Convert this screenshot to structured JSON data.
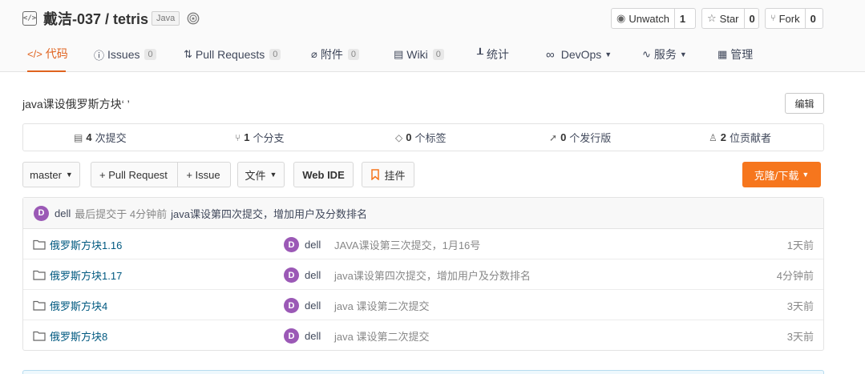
{
  "repo": {
    "title": "戴洁-037 / tetris",
    "language": "Java",
    "repo_icon": "code-repo-icon",
    "badge_icon": "recommend-badge-icon"
  },
  "social": {
    "watch": {
      "label": "Unwatch",
      "count": "1",
      "icon": "eye-icon"
    },
    "star": {
      "label": "Star",
      "count": "0",
      "icon": "star-icon"
    },
    "fork": {
      "label": "Fork",
      "count": "0",
      "icon": "fork-icon"
    }
  },
  "tabs": [
    {
      "label": "代码",
      "icon": "code-icon",
      "active": true
    },
    {
      "label": "Issues",
      "count": "0",
      "icon": "issue-icon"
    },
    {
      "label": "Pull Requests",
      "count": "0",
      "icon": "pull-request-icon"
    },
    {
      "label": "附件",
      "count": "0",
      "icon": "paperclip-icon"
    },
    {
      "label": "Wiki",
      "count": "0",
      "icon": "book-icon"
    },
    {
      "label": "统计",
      "icon": "bar-chart-icon"
    },
    {
      "label": "DevOps",
      "icon": "infinity-icon",
      "dropdown": true
    },
    {
      "label": "服务",
      "icon": "pulse-icon",
      "dropdown": true
    },
    {
      "label": "管理",
      "icon": "settings-doc-icon"
    }
  ],
  "description": "java课设俄罗斯方块‘ ’",
  "edit_label": "编辑",
  "stats": [
    {
      "count": "4",
      "label": "次提交",
      "icon": "commit-icon"
    },
    {
      "count": "1",
      "label": "个分支",
      "icon": "branch-icon"
    },
    {
      "count": "0",
      "label": "个标签",
      "icon": "tag-icon"
    },
    {
      "count": "0",
      "label": "个发行版",
      "icon": "release-icon"
    },
    {
      "count": "2",
      "label": "位贡献者",
      "icon": "contributors-icon"
    }
  ],
  "toolbar": {
    "branch": "master",
    "new_pr": "+ Pull Request",
    "new_issue": "+ Issue",
    "files": "文件",
    "web_ide": "Web IDE",
    "widget": "挂件",
    "clone": "克隆/下载"
  },
  "last_commit": {
    "avatar": "D",
    "author": "dell",
    "meta": "最后提交于 4分钟前",
    "message": "java课设第四次提交，增加用户及分数排名"
  },
  "files": [
    {
      "name": "俄罗斯方块1.16",
      "avatar": "D",
      "author": "dell",
      "message": "JAVA课设第三次提交，1月16号",
      "time": "1天前"
    },
    {
      "name": "俄罗斯方块1.17",
      "avatar": "D",
      "author": "dell",
      "message": "java课设第四次提交，增加用户及分数排名",
      "time": "4分钟前"
    },
    {
      "name": "俄罗斯方块4",
      "avatar": "D",
      "author": "dell",
      "message": "java 课设第二次提交",
      "time": "3天前"
    },
    {
      "name": "俄罗斯方块8",
      "avatar": "D",
      "author": "dell",
      "message": "java 课设第二次提交",
      "time": "3天前"
    }
  ],
  "colors": {
    "accent": "#e0631f",
    "clone_button": "#f6761d",
    "avatar": "#9b59b6",
    "link": "#005980"
  }
}
